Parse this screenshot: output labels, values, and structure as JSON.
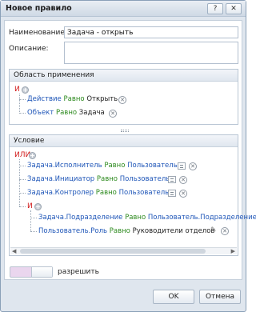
{
  "window": {
    "title": "Новое правило",
    "help_label": "?",
    "close_label": "✕"
  },
  "form": {
    "name_label": "Наименование:",
    "name_value": "Задача - открыть",
    "description_label": "Описание:",
    "description_value": ""
  },
  "scope": {
    "title": "Область применения",
    "operator": "И",
    "rules": [
      {
        "field": "Действие",
        "op": "Равно",
        "value": "Открыть"
      },
      {
        "field": "Объект",
        "op": "Равно",
        "value": "Задача"
      }
    ]
  },
  "condition": {
    "title": "Условие",
    "operator": "ИЛИ",
    "rules": [
      {
        "field": "Задача.Исполнитель",
        "op": "Равно",
        "value": "Пользователь"
      },
      {
        "field": "Задача.Инициатор",
        "op": "Равно",
        "value": "Пользователь"
      },
      {
        "field": "Задача.Контролер",
        "op": "Равно",
        "value": "Пользователь"
      }
    ],
    "sub_operator": "И",
    "sub_rules": [
      {
        "field": "Задача.Подразделение",
        "op": "Равно",
        "value": "Пользователь.Подразделение"
      },
      {
        "field": "Пользователь.Роль",
        "op": "Равно",
        "value": "Руководители отделов"
      }
    ]
  },
  "permission": {
    "label": "разрешить"
  },
  "buttons": {
    "ok": "OK",
    "cancel": "Отмена"
  },
  "icons": {
    "add": "plus-circle-icon",
    "remove": "close-circle-icon",
    "value_list": "equals-list-icon",
    "edit": "pencil-icon"
  },
  "colors": {
    "operator": "#d11a1a",
    "field": "#1f56b8",
    "op": "#2d8a1e",
    "toggle": "#ead6ee"
  }
}
